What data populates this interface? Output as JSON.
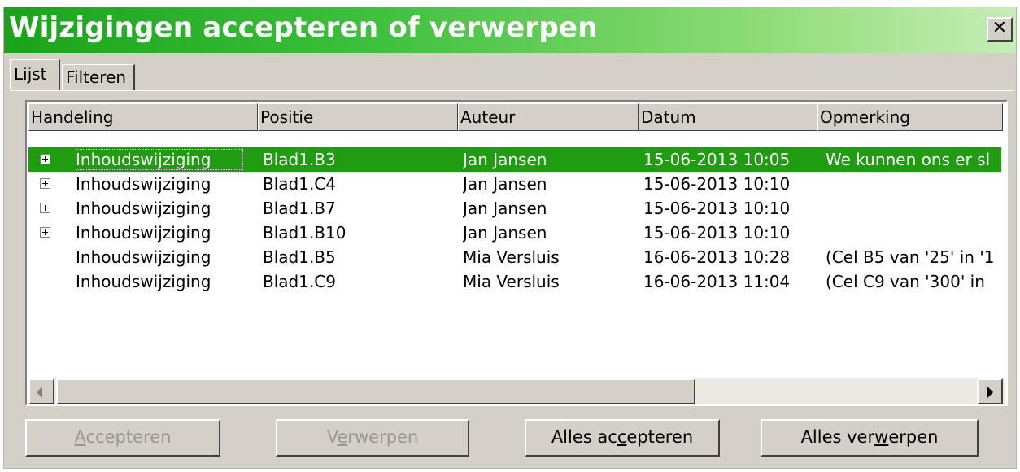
{
  "window": {
    "title": "Wijzigingen accepteren of verwerpen",
    "close_glyph": "✕"
  },
  "tabs": [
    {
      "label": "Lijst",
      "active": true
    },
    {
      "label": "Filteren",
      "active": false
    }
  ],
  "columns": [
    "Handeling",
    "Positie",
    "Auteur",
    "Datum",
    "Opmerking"
  ],
  "rows": [
    {
      "expand": true,
      "action": "Inhoudswijziging",
      "position": "Blad1.B3",
      "author": "Jan Jansen",
      "date": "15-06-2013 10:05",
      "comment": "We kunnen ons er sl",
      "selected": true
    },
    {
      "expand": true,
      "action": "Inhoudswijziging",
      "position": "Blad1.C4",
      "author": "Jan Jansen",
      "date": "15-06-2013 10:10",
      "comment": "",
      "selected": false
    },
    {
      "expand": true,
      "action": "Inhoudswijziging",
      "position": "Blad1.B7",
      "author": "Jan Jansen",
      "date": "15-06-2013 10:10",
      "comment": "",
      "selected": false
    },
    {
      "expand": true,
      "action": "Inhoudswijziging",
      "position": "Blad1.B10",
      "author": "Jan Jansen",
      "date": "15-06-2013 10:10",
      "comment": "",
      "selected": false
    },
    {
      "expand": false,
      "action": "Inhoudswijziging",
      "position": "Blad1.B5",
      "author": "Mia Versluis",
      "date": "16-06-2013 10:28",
      "comment": "(Cel B5 van '25' in '1",
      "selected": false
    },
    {
      "expand": false,
      "action": "Inhoudswijziging",
      "position": "Blad1.C9",
      "author": "Mia Versluis",
      "date": "16-06-2013 11:04",
      "comment": "(Cel C9 van '300' in",
      "selected": false
    }
  ],
  "buttons": {
    "accept": {
      "pre": "",
      "mnemonic": "A",
      "post": "ccepteren",
      "enabled": false
    },
    "reject": {
      "pre": "V",
      "mnemonic": "e",
      "post": "rwerpen",
      "enabled": false
    },
    "accept_all": {
      "pre": "Alles ac",
      "mnemonic": "c",
      "post": "epteren",
      "enabled": true
    },
    "reject_all": {
      "pre": "Alles ver",
      "mnemonic": "w",
      "post": "erpen",
      "enabled": true
    }
  },
  "colors": {
    "title_green": "#1aa31a",
    "selection_green": "#1f9c10",
    "dialog_face": "#d4d0c8"
  }
}
